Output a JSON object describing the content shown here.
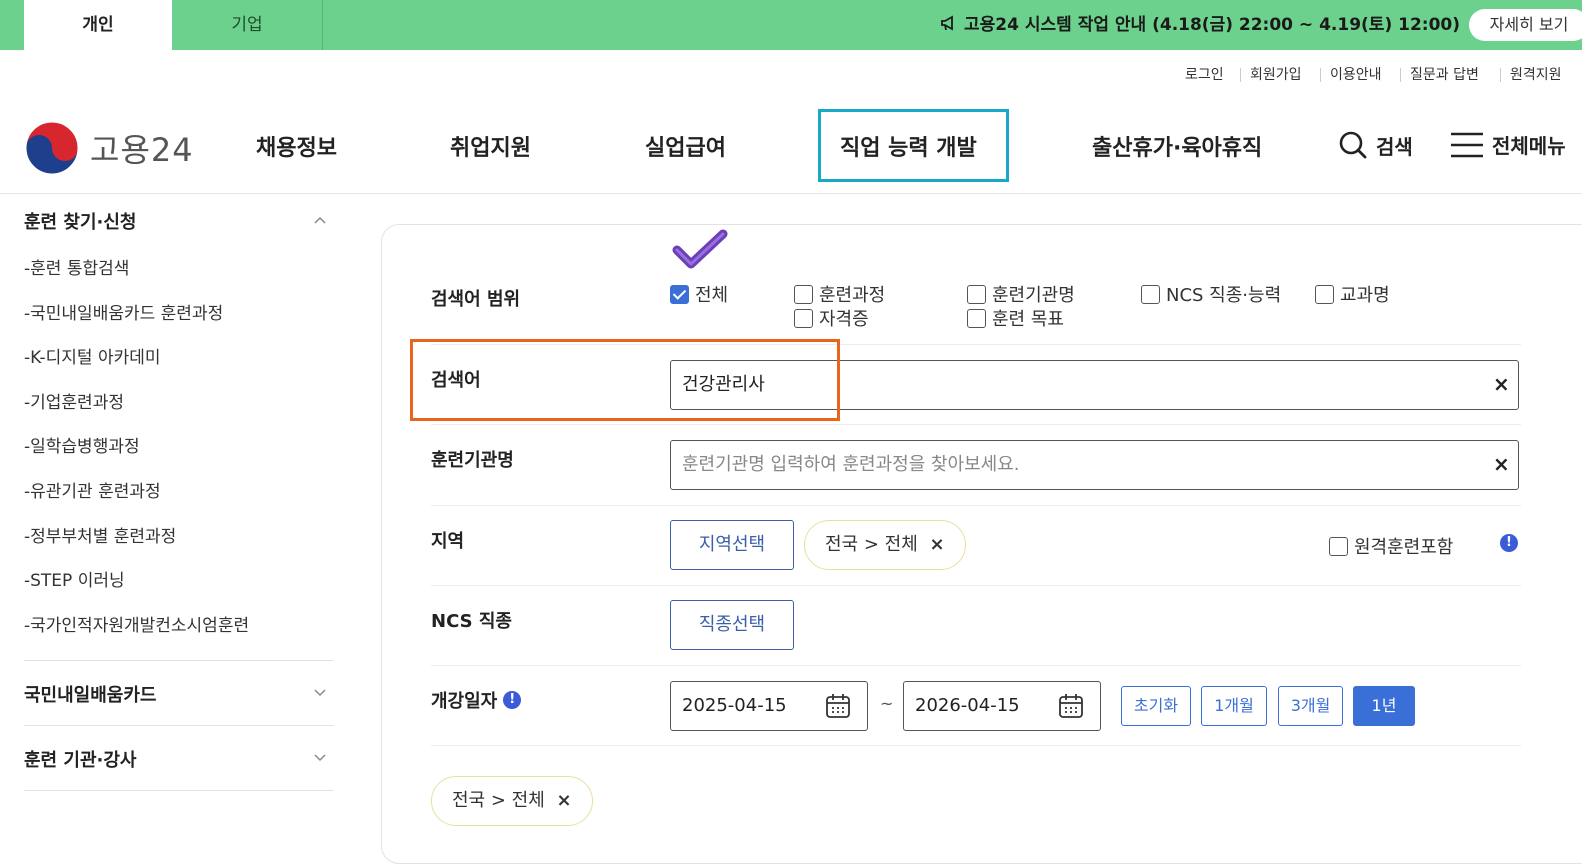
{
  "topbar": {
    "tabs": [
      "개인",
      "기업"
    ],
    "notice": "고용24 시스템 작업 안내 (4.18(금) 22:00 ~ 4.19(토) 12:00)",
    "notice_button": "자세히 보기"
  },
  "util_links": [
    "로그인",
    "회원가입",
    "이용안내",
    "질문과 답변",
    "원격지원"
  ],
  "header": {
    "logo_text": "고용24",
    "nav": [
      "채용정보",
      "취업지원",
      "실업급여",
      "직업 능력 개발",
      "출산휴가·육아휴직"
    ],
    "search_label": "검색",
    "menu_label": "전체메뉴"
  },
  "sidebar": {
    "section1": "훈련 찾기·신청",
    "items": [
      "-훈련 통합검색",
      "-국민내일배움카드 훈련과정",
      "-K-디지털 아카데미",
      "-기업훈련과정",
      "-일학습병행과정",
      "-유관기관 훈련과정",
      "-정부부처별 훈련과정",
      "-STEP 이러닝",
      "-국가인적자원개발컨소시엄훈련"
    ],
    "section2": "국민내일배움카드",
    "section3": "훈련 기관·강사"
  },
  "form": {
    "scope_label": "검색어 범위",
    "scope_options": [
      "전체",
      "훈련과정",
      "훈련기관명",
      "NCS 직종·능력",
      "교과명",
      "자격증",
      "훈련 목표"
    ],
    "keyword_label": "검색어",
    "keyword_value": "건강관리사",
    "institution_label": "훈련기관명",
    "institution_placeholder": "훈련기관명 입력하여 훈련과정을 찾아보세요.",
    "region_label": "지역",
    "region_button": "지역선택",
    "region_chip": "전국 > 전체",
    "remote_label": "원격훈련포함",
    "ncs_label": "NCS 직종",
    "ncs_button": "직종선택",
    "date_label": "개강일자",
    "date_from": "2025-04-15",
    "date_tilde": "~",
    "date_to": "2026-04-15",
    "period_buttons": [
      "초기화",
      "1개월",
      "3개월",
      "1년"
    ],
    "bottom_chip": "전국 > 전체",
    "clear_glyph": "×",
    "info_glyph": "!"
  },
  "colors": {
    "green": "#6dd18e",
    "highlight_blue": "#1aa8c8",
    "highlight_orange": "#e8651c",
    "primary": "#3b6fd8"
  }
}
